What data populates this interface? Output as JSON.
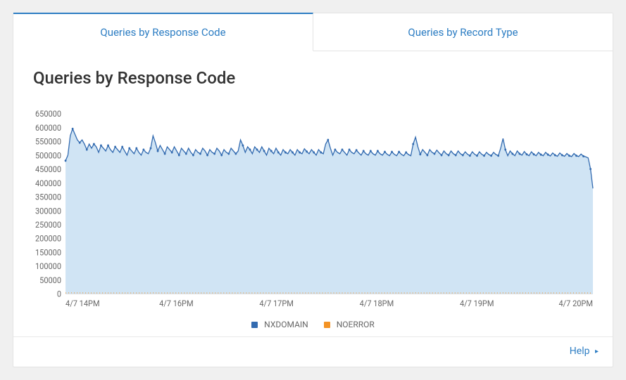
{
  "tabs": [
    {
      "label": "Queries by Response Code"
    },
    {
      "label": "Queries by Record Type"
    }
  ],
  "footer": {
    "help_label": "Help"
  },
  "colors": {
    "primary": "#2c7dc3",
    "series_nxdomain": "#336bb0",
    "series_noerror": "#f39325",
    "area_fill": "#d0e4f4"
  },
  "chart_data": {
    "type": "area",
    "title": "Queries by Response Code",
    "xlabel": "",
    "ylabel": "",
    "ylim": [
      0,
      650000
    ],
    "yticks": [
      0,
      50000,
      100000,
      150000,
      200000,
      250000,
      300000,
      350000,
      400000,
      450000,
      500000,
      550000,
      600000,
      650000
    ],
    "x_tick_labels": [
      "4/7 14PM",
      "4/7 16PM",
      "4/7 17PM",
      "4/7 18PM",
      "4/7 19PM",
      "4/7 20PM"
    ],
    "series": [
      {
        "name": "NXDOMAIN",
        "color": "#336bb0",
        "values": [
          480000,
          500000,
          570000,
          595000,
          575000,
          555000,
          545000,
          555000,
          540000,
          520000,
          540000,
          525000,
          540000,
          530000,
          510000,
          535000,
          525000,
          515000,
          535000,
          520000,
          510000,
          530000,
          520000,
          510000,
          530000,
          515000,
          500000,
          525000,
          515000,
          505000,
          525000,
          510000,
          500000,
          520000,
          510000,
          505000,
          525000,
          570000,
          545000,
          515000,
          535000,
          520000,
          505000,
          530000,
          520000,
          510000,
          530000,
          515000,
          500000,
          525000,
          515000,
          505000,
          525000,
          510000,
          500000,
          520000,
          510000,
          505000,
          525000,
          515000,
          500000,
          520000,
          510000,
          505000,
          525000,
          515000,
          500000,
          520000,
          510000,
          505000,
          525000,
          515000,
          505000,
          515000,
          555000,
          535000,
          510000,
          530000,
          520000,
          505000,
          530000,
          520000,
          510000,
          530000,
          515000,
          500000,
          525000,
          515000,
          505000,
          525000,
          510000,
          500000,
          520000,
          510000,
          505000,
          520000,
          510000,
          500000,
          520000,
          510000,
          505000,
          523000,
          513000,
          505000,
          520000,
          510000,
          500000,
          520000,
          510000,
          505000,
          540000,
          555000,
          525000,
          500000,
          520000,
          510000,
          505000,
          520000,
          510000,
          500000,
          520000,
          510000,
          505000,
          518000,
          508000,
          500000,
          515000,
          505000,
          500000,
          515000,
          505000,
          500000,
          515000,
          505000,
          500000,
          512000,
          503000,
          498000,
          512000,
          503000,
          498000,
          512000,
          503000,
          498000,
          510000,
          502000,
          498000,
          540000,
          565000,
          530000,
          503000,
          520000,
          510000,
          500000,
          520000,
          510000,
          505000,
          518000,
          508000,
          500000,
          515000,
          505000,
          500000,
          515000,
          505000,
          500000,
          515000,
          505000,
          500000,
          512000,
          503000,
          498000,
          512000,
          503000,
          498000,
          512000,
          503000,
          498000,
          510000,
          502000,
          498000,
          510000,
          502000,
          498000,
          525000,
          560000,
          520000,
          498000,
          515000,
          505000,
          498000,
          515000,
          505000,
          500000,
          513000,
          503000,
          498000,
          512000,
          503000,
          498000,
          510000,
          502000,
          498000,
          510000,
          502000,
          497000,
          508000,
          500000,
          496000,
          508000,
          500000,
          496000,
          506000,
          498000,
          495000,
          506000,
          498000,
          495000,
          504000,
          496000,
          494000,
          490000,
          450000,
          380000
        ]
      },
      {
        "name": "NOERROR",
        "color": "#f39325",
        "values": [
          3000,
          3200,
          3500,
          3400,
          3300,
          3200,
          3200,
          3300,
          3100,
          3000,
          3100,
          3000,
          3100,
          3050,
          2950,
          3050,
          3000,
          2950,
          3050,
          3000,
          2950,
          3020,
          2980,
          2940,
          3020,
          2970,
          2920,
          3000,
          2960,
          2920,
          3000,
          2950,
          2910,
          2990,
          2950,
          2920,
          3000,
          3400,
          3200,
          2950,
          3050,
          2990,
          2930,
          3020,
          2980,
          2940,
          3020,
          2970,
          2920,
          3000,
          2960,
          2920,
          3000,
          2950,
          2910,
          2990,
          2950,
          2920,
          3000,
          2960,
          2920,
          2990,
          2950,
          2920,
          3000,
          2960,
          2920,
          2990,
          2950,
          2920,
          3000,
          2960,
          2930,
          2965,
          3250,
          3100,
          2940,
          3020,
          2980,
          2930,
          3020,
          2980,
          2940,
          3020,
          2970,
          2920,
          3000,
          2960,
          2920,
          3000,
          2950,
          2910,
          2990,
          2950,
          2920,
          2990,
          2950,
          2910,
          2990,
          2950,
          2920,
          2995,
          2955,
          2920,
          2990,
          2950,
          2910,
          2990,
          2950,
          2920,
          3100,
          3250,
          3015,
          2910,
          2990,
          2950,
          2920,
          2990,
          2950,
          2910,
          2990,
          2950,
          2920,
          2985,
          2945,
          2910,
          2975,
          2930,
          2905,
          2975,
          2930,
          2905,
          2975,
          2930,
          2905,
          2965,
          2920,
          2895,
          2965,
          2920,
          2895,
          2965,
          2920,
          2895,
          2955,
          2915,
          2895,
          3100,
          3320,
          3030,
          2910,
          2990,
          2950,
          2910,
          2990,
          2950,
          2920,
          2985,
          2945,
          2910,
          2975,
          2930,
          2905,
          2975,
          2930,
          2905,
          2975,
          2930,
          2905,
          2965,
          2920,
          2895,
          2965,
          2920,
          2895,
          2965,
          2920,
          2895,
          2955,
          2915,
          2895,
          2955,
          2915,
          2895,
          3015,
          3290,
          2990,
          2895,
          2975,
          2930,
          2895,
          2975,
          2930,
          2905,
          2970,
          2920,
          2895,
          2965,
          2920,
          2895,
          2955,
          2915,
          2895,
          2955,
          2915,
          2890,
          2945,
          2905,
          2885,
          2945,
          2905,
          2885,
          2935,
          2895,
          2880,
          2935,
          2895,
          2880,
          2925,
          2885,
          2875,
          2850,
          2600,
          2200
        ]
      }
    ]
  }
}
